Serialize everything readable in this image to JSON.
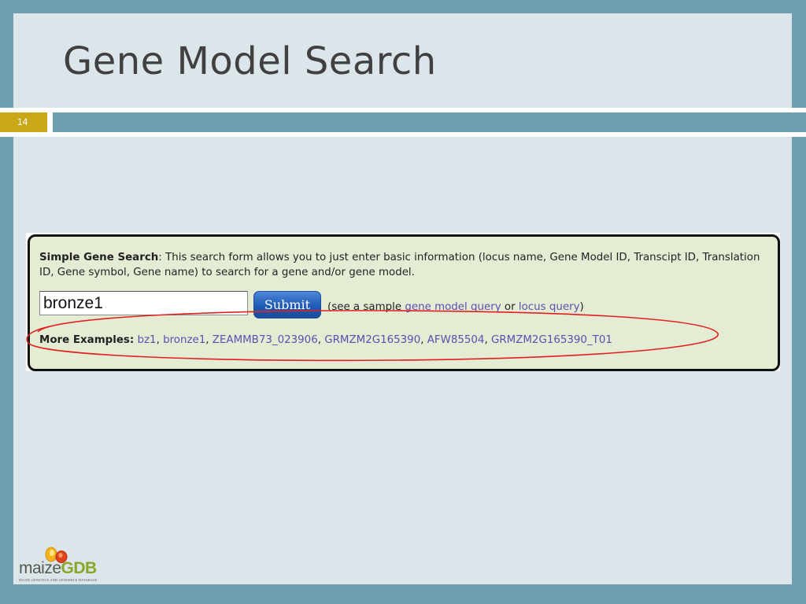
{
  "slide": {
    "title": "Gene Model Search",
    "number": "14"
  },
  "search_form": {
    "heading": "Simple Gene Search",
    "description": ": This search form allows you to just enter basic information (locus name, Gene Model ID, Transcipt ID, Translation ID, Gene symbol, Gene name) to search for a gene and/or gene model.",
    "input_value": "bronze1",
    "submit_label": "Submit",
    "sample_prefix": "(see a sample ",
    "sample_link_1": "gene model query",
    "sample_or": " or ",
    "sample_link_2": "locus query",
    "sample_suffix": ")",
    "examples_label": "More Examples:",
    "examples": [
      "bz1",
      "bronze1",
      "ZEAMMB73_023906",
      "GRMZM2G165390",
      "AFW85504",
      "GRMZM2G165390_T01"
    ]
  },
  "logo": {
    "maize": "maize",
    "gdb": "GDB",
    "tagline": "MAIZE GENETICS AND GENOMICS DATABASE"
  },
  "colors": {
    "frame": "#6fa0b1",
    "slide_bg": "#dce6ea",
    "number_badge": "#c9a716",
    "panel_bg": "#e5ecd4",
    "link": "#5a4fb0",
    "highlight_ellipse": "#e02020"
  },
  "annotation": {
    "type": "hand-drawn-ellipse",
    "highlights": "search_form.examples"
  }
}
